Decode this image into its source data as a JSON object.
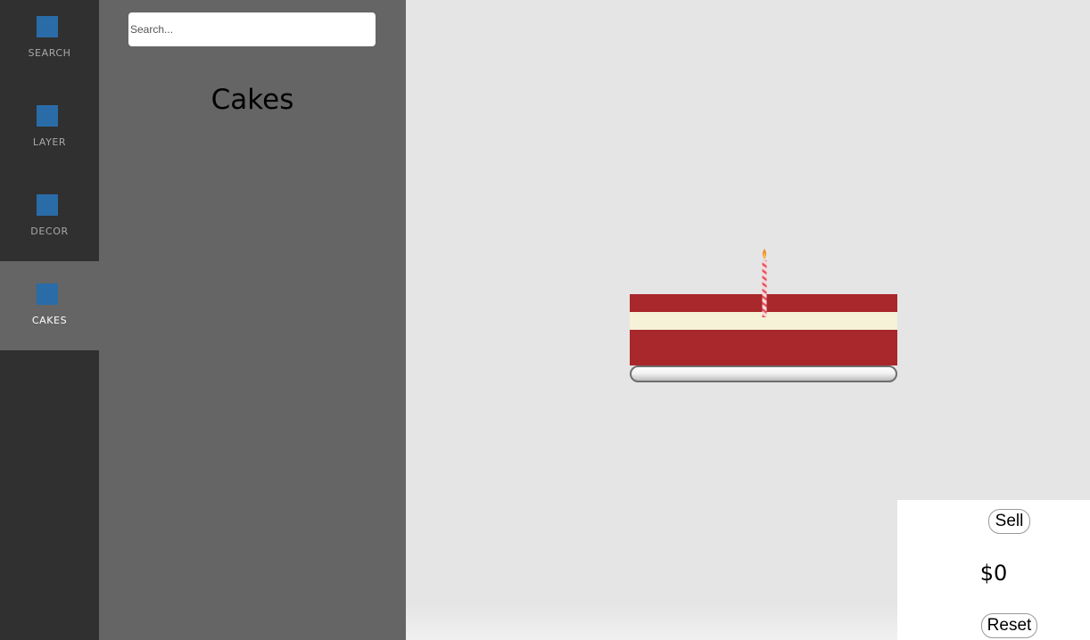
{
  "nav": {
    "items": [
      {
        "label": "SEARCH",
        "active": false
      },
      {
        "label": "LAYER",
        "active": false
      },
      {
        "label": "DECOR",
        "active": false
      },
      {
        "label": "CAKES",
        "active": true
      }
    ],
    "icon_color": "#2a6ca8"
  },
  "panel": {
    "search_placeholder": "Search...",
    "title": "Cakes"
  },
  "cake": {
    "layers": [
      "red-velvet",
      "cream",
      "red-velvet"
    ],
    "decor": [
      "candle"
    ],
    "colors": {
      "sponge": "#a8282b",
      "cream": "#f5f2d8",
      "candle_stripe": "#e8505b",
      "flame": "#f08a24"
    }
  },
  "controls": {
    "sell_label": "Sell",
    "money": "$0",
    "reset_label": "Reset"
  }
}
